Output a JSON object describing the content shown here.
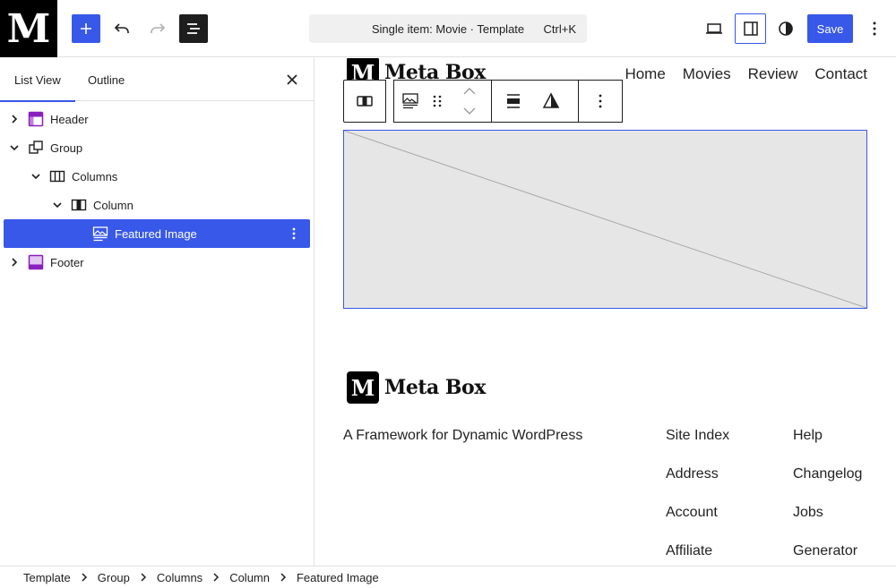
{
  "topbar": {
    "site_logo_letter": "M",
    "command": {
      "title": "Single item: Movie · Template",
      "shortcut": "Ctrl+K"
    },
    "save_label": "Save",
    "accent": "#3858e9",
    "icons": [
      "plus-icon",
      "undo-icon",
      "redo-icon",
      "list-view-icon",
      "laptop-icon",
      "sidebar-icon",
      "contrast-icon",
      "kebab-icon"
    ]
  },
  "sidebar": {
    "tabs": [
      {
        "label": "List View"
      },
      {
        "label": "Outline"
      }
    ],
    "tree": [
      {
        "label": "Header",
        "icon": "header-icon"
      },
      {
        "label": "Group",
        "icon": "group-icon"
      },
      {
        "label": "Columns",
        "icon": "columns-icon"
      },
      {
        "label": "Column",
        "icon": "column-icon"
      },
      {
        "label": "Featured Image",
        "icon": "featured-image-icon",
        "selected": true
      },
      {
        "label": "Footer",
        "icon": "footer-icon"
      }
    ]
  },
  "canvas": {
    "logo_letter": "M",
    "brand": "Meta Box",
    "nav": [
      "Home",
      "Movies",
      "Review",
      "Contact"
    ],
    "footer": {
      "logo_letter": "M",
      "brand": "Meta Box",
      "tagline": "A Framework for Dynamic WordPress",
      "col1": [
        "Site Index",
        "Address",
        "Account",
        "Affiliate"
      ],
      "col2": [
        "Help",
        "Changelog",
        "Jobs",
        "Generator"
      ]
    }
  },
  "breadcrumb": [
    "Template",
    "Group",
    "Columns",
    "Column",
    "Featured Image"
  ]
}
